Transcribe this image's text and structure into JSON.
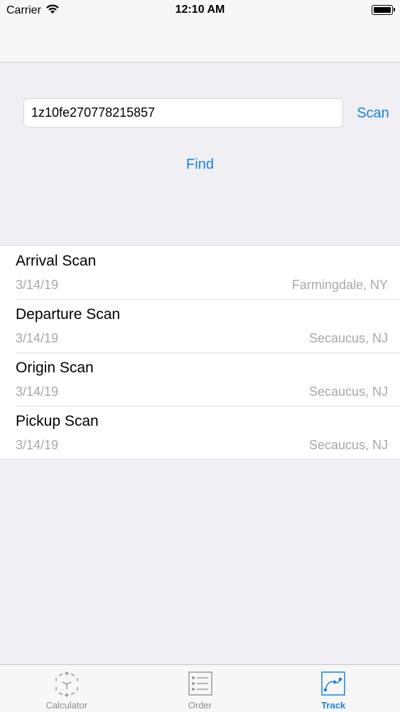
{
  "status_bar": {
    "carrier": "Carrier",
    "time": "12:10 AM"
  },
  "search": {
    "tracking_number": "1z10fe270778215857",
    "scan_label": "Scan",
    "find_label": "Find"
  },
  "scans": [
    {
      "title": "Arrival Scan",
      "date": "3/14/19",
      "location": "Farmingdale, NY"
    },
    {
      "title": "Departure Scan",
      "date": "3/14/19",
      "location": "Secaucus, NJ"
    },
    {
      "title": "Origin Scan",
      "date": "3/14/19",
      "location": "Secaucus, NJ"
    },
    {
      "title": "Pickup Scan",
      "date": "3/14/19",
      "location": "Secaucus, NJ"
    }
  ],
  "tabs": [
    {
      "label": "Calculator",
      "icon": "calculator-cube-icon",
      "active": false
    },
    {
      "label": "Order",
      "icon": "order-list-icon",
      "active": false
    },
    {
      "label": "Track",
      "icon": "track-route-icon",
      "active": true
    }
  ],
  "colors": {
    "accent": "#1a82e0",
    "background": "#efeff4",
    "secondary_text": "#a8a8ad"
  }
}
